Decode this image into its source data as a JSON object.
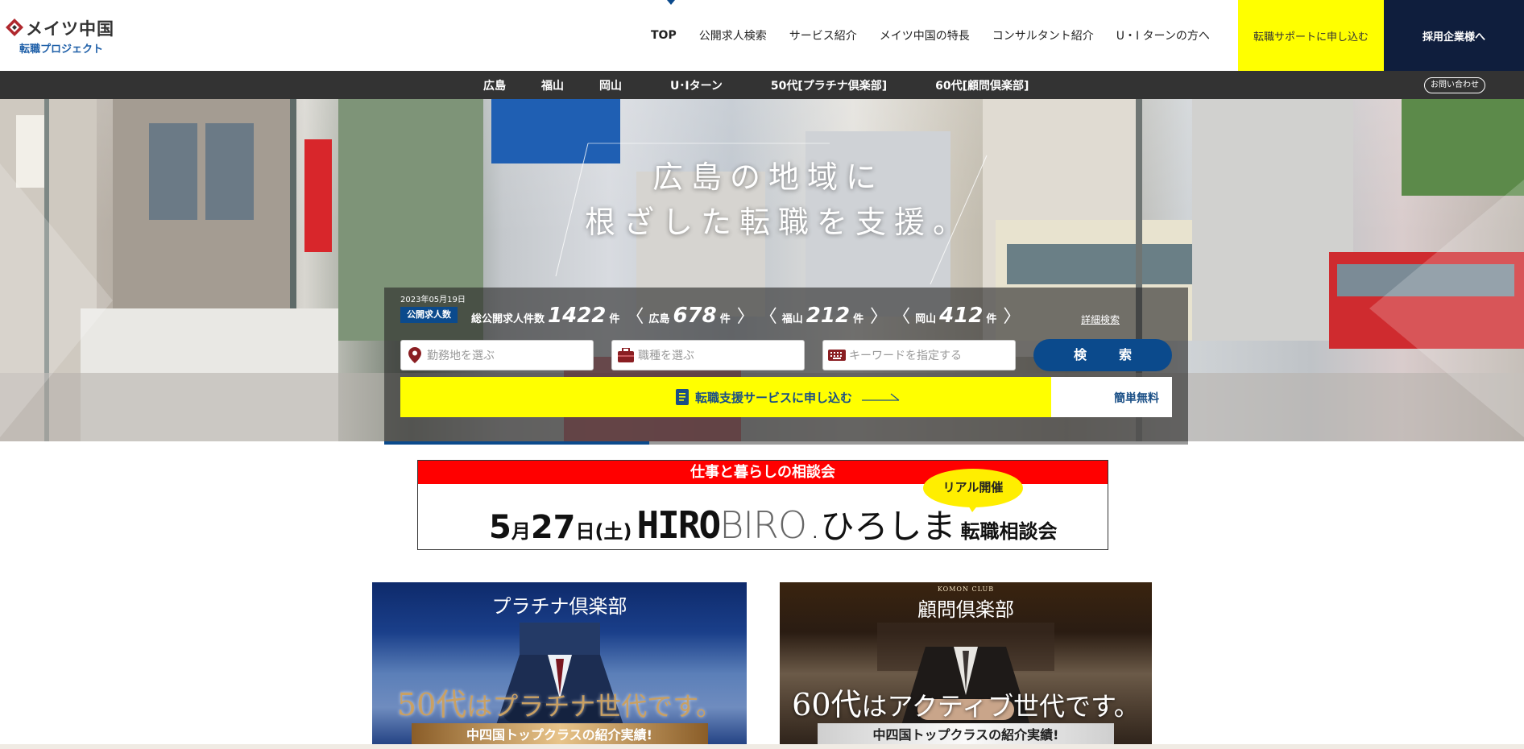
{
  "header": {
    "logo_name": "メイツ中国",
    "logo_sub": "転職プロジェクト",
    "nav": [
      "TOP",
      "公開求人検索",
      "サービス紹介",
      "メイツ中国の特長",
      "コンサルタント紹介",
      "U・I ターンの方へ"
    ],
    "support_button": "転職サポートに申し込む",
    "company_button": "採用企業様へ"
  },
  "subnav": {
    "items": [
      "広島",
      "福山",
      "岡山",
      "U･Iターン",
      "50代[プラチナ倶楽部]",
      "60代[顧問倶楽部]"
    ],
    "contact": "お問い合わせ"
  },
  "hero": {
    "title_line1": "広島の地域に",
    "title_line2": "根ざした転職を支援。"
  },
  "search": {
    "date": "2023年05月19日",
    "badge": "公開求人数",
    "total_label": "総公開求人件数",
    "total": "1422",
    "unit": "件",
    "regions": [
      {
        "name": "広島",
        "count": "678"
      },
      {
        "name": "福山",
        "count": "212"
      },
      {
        "name": "岡山",
        "count": "412"
      }
    ],
    "advanced_link": "詳細検索",
    "location_placeholder": "勤務地を選ぶ",
    "job_placeholder": "職種を選ぶ",
    "keyword_placeholder": "キーワードを指定する",
    "search_button": "検　索",
    "apply_text": "転職支援サービスに申し込む",
    "apply_easy": "簡単無料",
    "slider_progress": 0.33
  },
  "event": {
    "header": "仕事と暮らしの相談会",
    "bubble": "リアル開催",
    "month": "5",
    "month_unit": "月",
    "day": "27",
    "day_unit": "日",
    "weekday": "(土)",
    "brand_a": "HIRO",
    "brand_b": "BIRO",
    "brand_hira": ".ひろしま",
    "suffix": "転職相談会"
  },
  "cards": {
    "platinum": {
      "title": "プラチナ倶楽部",
      "slogan_num": "50代",
      "slogan_rest": "はプラチナ世代です。",
      "ribbon": "中四国トップクラスの紹介実績!"
    },
    "komon": {
      "subtitle": "KOMON CLUB",
      "title": "顧問倶楽部",
      "slogan_num": "60代",
      "slogan_rest": "はアクティブ世代です。",
      "ribbon": "中四国トップクラスの紹介実績!"
    }
  },
  "colors": {
    "brand_blue": "#0b4a8c",
    "accent_yellow": "#ffff00",
    "navy": "#0f1e3d",
    "event_red": "#ff0000"
  }
}
